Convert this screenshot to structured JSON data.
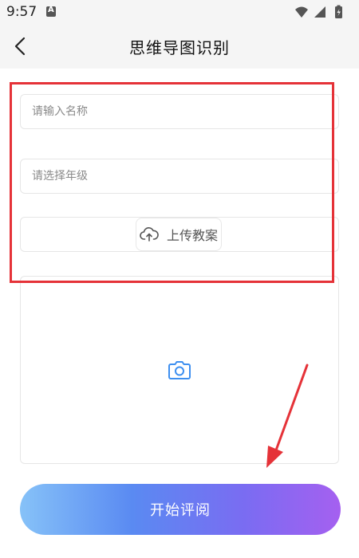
{
  "status_bar": {
    "time": "9:57",
    "app_icon": "a-icon",
    "icons": [
      "wifi-icon",
      "signal-icon",
      "battery-charging-icon"
    ]
  },
  "header": {
    "title": "思维导图识别",
    "back_icon": "chevron-left-icon"
  },
  "form": {
    "name_placeholder": "请输入名称",
    "name_value": "",
    "grade_placeholder": "请选择年级",
    "grade_value": "",
    "upload_label": "上传教案",
    "upload_icon": "cloud-upload-icon",
    "photo_icon": "camera-icon"
  },
  "start_button": {
    "label": "开始评阅"
  },
  "annotations": {
    "highlight_color": "#e53238",
    "arrow_color": "#e53238"
  },
  "colors": {
    "button_gradient": [
      "#86c2f8",
      "#5a8af2",
      "#7a6cf2",
      "#a560f0"
    ],
    "camera_icon": "#3d8ff0"
  }
}
